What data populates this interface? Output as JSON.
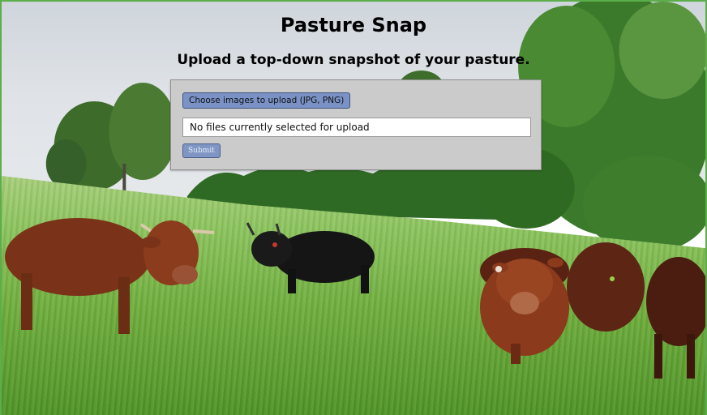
{
  "header": {
    "title": "Pasture Snap",
    "subtitle": "Upload a top-down snapshot of your pasture."
  },
  "upload": {
    "choose_label": "Choose images to upload (JPG, PNG)",
    "status_text": "No files currently selected for upload",
    "submit_label": "Submit"
  },
  "colors": {
    "button_fill": "#7a92c6",
    "panel_fill": "#cbcbcb",
    "page_border": "#5cae4a"
  }
}
